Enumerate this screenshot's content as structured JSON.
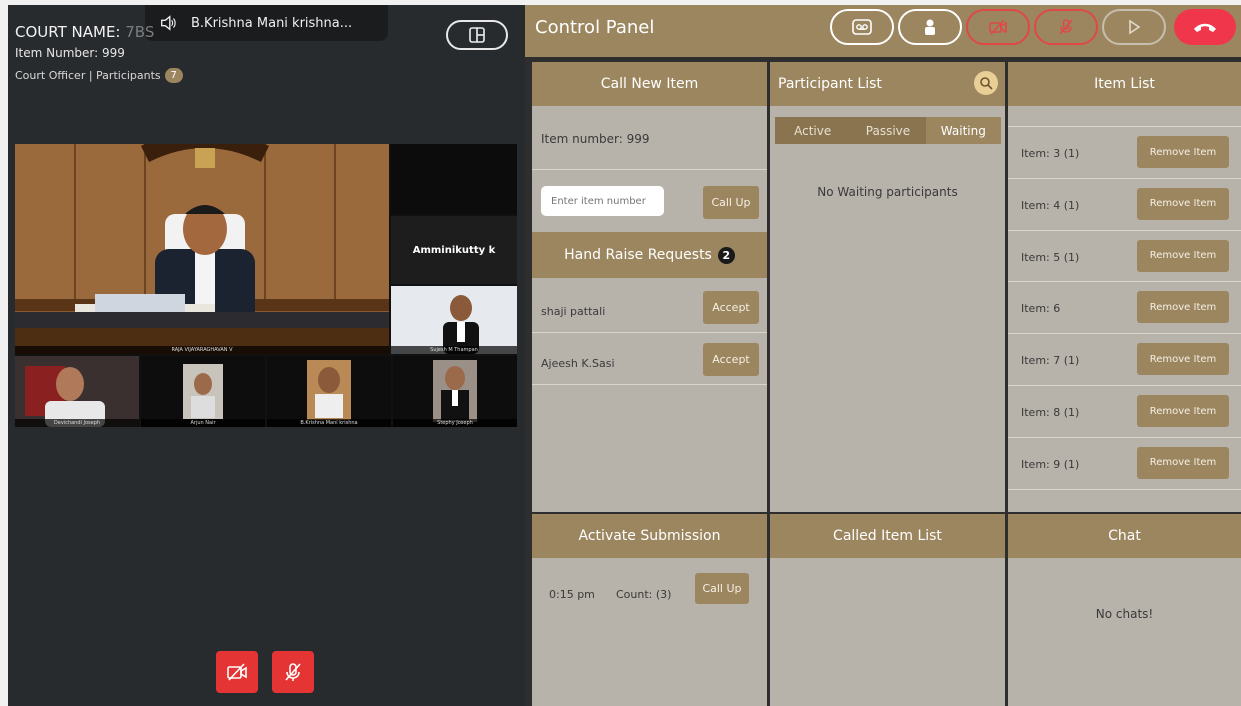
{
  "left": {
    "speaker": "B.Krishna Mani krishna...",
    "court_name_label": "COURT NAME:",
    "court_name_value": "7BS",
    "item_number": "Item Number: 999",
    "officer_label": "Court Officer | Participants",
    "participants_count": "7",
    "side_name": "Amminikutty k",
    "tile_labels": [
      "Devichandi Joseph",
      "Sujesh M Thampan",
      "Arjun Nair",
      "B.Krishna Mani krishna",
      "Stephy Joseph"
    ],
    "main_label": "RAJA VIJAYARAGHAVAN V"
  },
  "control_panel": {
    "title": "Control Panel",
    "call_new_item": {
      "header": "Call New Item",
      "item_number_text": "Item number: 999",
      "input_placeholder": "Enter item number",
      "call_up_label": "Call Up"
    },
    "hand_raise": {
      "header": "Hand Raise Requests",
      "count": "2",
      "requests": [
        {
          "name": "shaji pattali",
          "action": "Accept"
        },
        {
          "name": "Ajeesh K.Sasi",
          "action": "Accept"
        }
      ]
    },
    "participant_list": {
      "header": "Participant List",
      "tabs": [
        "Active",
        "Passive",
        "Waiting"
      ],
      "active_tab": "Waiting",
      "empty_text": "No Waiting participants"
    },
    "item_list": {
      "header": "Item List",
      "items": [
        {
          "label": "Item: 3 (1)",
          "action": "Remove Item"
        },
        {
          "label": "Item: 4 (1)",
          "action": "Remove Item"
        },
        {
          "label": "Item: 5 (1)",
          "action": "Remove Item"
        },
        {
          "label": "Item: 6",
          "action": "Remove Item"
        },
        {
          "label": "Item: 7 (1)",
          "action": "Remove Item"
        },
        {
          "label": "Item: 8 (1)",
          "action": "Remove Item"
        },
        {
          "label": "Item: 9 (1)",
          "action": "Remove Item"
        }
      ]
    },
    "activate_submission": {
      "header": "Activate Submission",
      "time": "0:15 pm",
      "count_text": "Count: (3)",
      "call_up_label": "Call Up"
    },
    "called_item_list": {
      "header": "Called Item List"
    },
    "chat": {
      "header": "Chat",
      "empty_text": "No chats!"
    }
  },
  "colors": {
    "accent": "#9c8660",
    "panel": "#b7b2aa",
    "danger": "#e53434",
    "dark": "#282b2e"
  }
}
